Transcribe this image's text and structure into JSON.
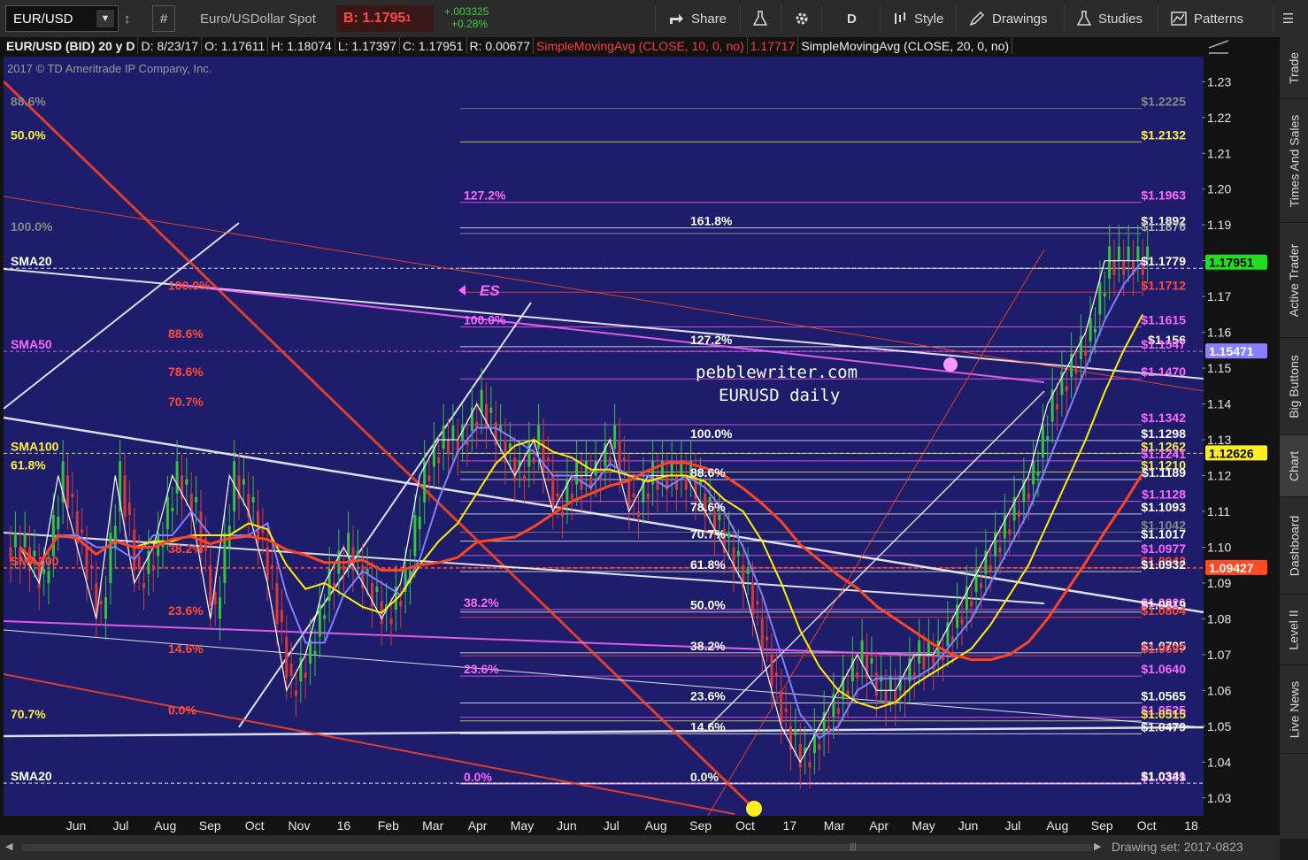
{
  "toolbar": {
    "symbol": "EUR/USD",
    "description": "Euro/USDollar Spot",
    "bid_label": "B: 1.1795",
    "bid_small": "1",
    "change_abs": "+.003325",
    "change_pct": "+0.28%",
    "share": "Share",
    "period": "D",
    "style": "Style",
    "drawings": "Drawings",
    "studies": "Studies",
    "patterns": "Patterns"
  },
  "infobar": {
    "title": "EUR/USD (BID) 20 y D",
    "date": "D: 8/23/17",
    "open": "O: 1.17611",
    "high": "H: 1.18074",
    "low": "L: 1.17397",
    "close": "C: 1.17951",
    "range": "R: 0.00677",
    "sma10_label": "SimpleMovingAvg (CLOSE, 10, 0, no)",
    "sma10_value": "1.17717",
    "sma20_label": "SimpleMovingAvg (CLOSE, 20, 0, no)"
  },
  "copyright": "2017 © TD Ameritrade IP Company, Inc.",
  "watermark": {
    "site": "pebblewriter.com",
    "subtitle": "EURUSD daily",
    "es": "ES"
  },
  "side_tabs": [
    "Trade",
    "Times And Sales",
    "Active Trader",
    "Big Buttons",
    "Chart",
    "Dashboard",
    "Level II",
    "Live News"
  ],
  "active_tab": "Chart",
  "statusbar": {
    "drawing_set": "Drawing set: 2017-0823"
  },
  "colors": {
    "background": "#1d1d6b",
    "candle_up": "#36c23a",
    "candle_down": "#d33a3a",
    "fib_red": "#ff4a3a",
    "fib_magenta": "#ff66ff",
    "fib_white": "#ffffff",
    "fib_yellow": "#ffee44",
    "sma10": "#ffffff",
    "sma20": "#7f80ff",
    "sma50": "#ffee00",
    "sma200": "#ff4422"
  },
  "chart_data": {
    "type": "line",
    "title": "",
    "ylim": [
      1.025,
      1.237
    ],
    "y_ticks": [
      1.03,
      1.04,
      1.05,
      1.06,
      1.07,
      1.08,
      1.09,
      1.1,
      1.11,
      1.12,
      1.13,
      1.14,
      1.15,
      1.16,
      1.17,
      1.18,
      1.19,
      1.2,
      1.21,
      1.22,
      1.23
    ],
    "x_months": [
      "Jun",
      "Jul",
      "Aug",
      "Sep",
      "Oct",
      "Nov",
      "16",
      "Feb",
      "Mar",
      "Apr",
      "May",
      "Jun",
      "Jul",
      "Aug",
      "Sep",
      "Oct",
      "17",
      "Mar",
      "Apr",
      "May",
      "Jun",
      "Jul",
      "Aug",
      "Sep",
      "Oct",
      "18"
    ],
    "close_series": [
      1.1,
      1.09,
      1.12,
      1.1,
      1.08,
      1.12,
      1.09,
      1.1,
      1.12,
      1.11,
      1.08,
      1.12,
      1.11,
      1.09,
      1.06,
      1.07,
      1.09,
      1.1,
      1.09,
      1.08,
      1.09,
      1.12,
      1.13,
      1.13,
      1.14,
      1.13,
      1.12,
      1.13,
      1.11,
      1.12,
      1.12,
      1.13,
      1.11,
      1.12,
      1.12,
      1.12,
      1.11,
      1.1,
      1.09,
      1.07,
      1.05,
      1.04,
      1.05,
      1.06,
      1.07,
      1.06,
      1.06,
      1.07,
      1.07,
      1.08,
      1.09,
      1.1,
      1.11,
      1.12,
      1.14,
      1.15,
      1.16,
      1.18,
      1.18,
      1.18
    ],
    "series": [
      {
        "name": "SimpleMovingAvg (CLOSE, 10, 0, no)",
        "color": "#ffffff"
      },
      {
        "name": "SimpleMovingAvg (CLOSE, 20, 0, no)",
        "color": "#7f80ff"
      },
      {
        "name": "SMA50",
        "color": "#ffee00"
      },
      {
        "name": "SMA200",
        "color": "#ff4422"
      }
    ],
    "right_axis_badges": [
      {
        "label": "1.17951",
        "value": 1.1795,
        "bg": "#22dd22",
        "fg": "#000000"
      },
      {
        "label": "1.15471",
        "value": 1.1547,
        "bg": "#8a80ff",
        "fg": "#ffffff"
      },
      {
        "label": "1.12626",
        "value": 1.1262,
        "bg": "#ffee22",
        "fg": "#000000"
      },
      {
        "label": "1.09427",
        "value": 1.0942,
        "bg": "#ff4a22",
        "fg": "#ffffff"
      }
    ],
    "price_labels": [
      {
        "text": "$1.2225",
        "value": 1.2225,
        "color": "#888888"
      },
      {
        "text": "$1.2132",
        "value": 1.2132,
        "color": "#ffee44"
      },
      {
        "text": "$1.1963",
        "value": 1.1963,
        "color": "#ff66ff"
      },
      {
        "text": "$1.1892",
        "value": 1.1892,
        "color": "#ffffff"
      },
      {
        "text": "$1.1876",
        "value": 1.1876,
        "color": "#aaaaaa"
      },
      {
        "text": "$1.1779",
        "value": 1.1779,
        "color": "#ffffff"
      },
      {
        "text": "$1.1712",
        "value": 1.1712,
        "color": "#ff4a3a"
      },
      {
        "text": "$1.1615",
        "value": 1.1615,
        "color": "#ff66ff"
      },
      {
        "text": "$1.156",
        "value": 1.156,
        "color": "#ffffff"
      },
      {
        "text": "$1.1547",
        "value": 1.1547,
        "color": "#ff66ff"
      },
      {
        "text": "$1.1470",
        "value": 1.147,
        "color": "#ff66ff"
      },
      {
        "text": "$1.1342",
        "value": 1.1342,
        "color": "#ff66ff"
      },
      {
        "text": "$1.1298",
        "value": 1.1298,
        "color": "#ffffff"
      },
      {
        "text": "$1.1262",
        "value": 1.1262,
        "color": "#ffee44"
      },
      {
        "text": "$1.1241",
        "value": 1.1241,
        "color": "#ff66ff"
      },
      {
        "text": "$1.1210",
        "value": 1.121,
        "color": "#ffee44"
      },
      {
        "text": "$1.1189",
        "value": 1.1189,
        "color": "#ffffff"
      },
      {
        "text": "$1.1128",
        "value": 1.1128,
        "color": "#ff66ff"
      },
      {
        "text": "$1.1093",
        "value": 1.1093,
        "color": "#ffffff"
      },
      {
        "text": "$1.1042",
        "value": 1.1042,
        "color": "#888888"
      },
      {
        "text": "$1.1017",
        "value": 1.1017,
        "color": "#ffffff"
      },
      {
        "text": "$1.0977",
        "value": 1.0977,
        "color": "#ff66ff"
      },
      {
        "text": "$1.0942",
        "value": 1.0942,
        "color": "#ff4a3a"
      },
      {
        "text": "$1.0932",
        "value": 1.0932,
        "color": "#ffffff"
      },
      {
        "text": "$1.0826",
        "value": 1.0826,
        "color": "#ff66ff"
      },
      {
        "text": "$1.0819",
        "value": 1.0819,
        "color": "#ffffff"
      },
      {
        "text": "$1.0804",
        "value": 1.0804,
        "color": "#ff4a3a"
      },
      {
        "text": "$1.0705",
        "value": 1.0705,
        "color": "#ffffff"
      },
      {
        "text": "$1.0697",
        "value": 1.0697,
        "color": "#ff4a3a"
      },
      {
        "text": "$1.0640",
        "value": 1.064,
        "color": "#ff66ff"
      },
      {
        "text": "$1.0565",
        "value": 1.0565,
        "color": "#ffffff"
      },
      {
        "text": "$1.0525",
        "value": 1.0525,
        "color": "#ff66ff"
      },
      {
        "text": "$1.0515",
        "value": 1.0515,
        "color": "#ffee44"
      },
      {
        "text": "$1.0479",
        "value": 1.0479,
        "color": "#ffffff"
      },
      {
        "text": "$1.0339",
        "value": 1.0339,
        "color": "#ffffff"
      },
      {
        "text": "$1.0339",
        "value": 1.0339,
        "color": "#ff66ff"
      },
      {
        "text": "$1.0341",
        "value": 1.0341,
        "color": "#ffffff"
      }
    ],
    "fib_labels": [
      {
        "text": "88.6%",
        "value": 1.2225,
        "color": "#888888"
      },
      {
        "text": "50.0%",
        "value": 1.2132,
        "color": "#ffee44"
      },
      {
        "text": "127.2%",
        "value": 1.1963,
        "color": "#ff66ff"
      },
      {
        "text": "161.8%",
        "value": 1.1892,
        "color": "#ffffff"
      },
      {
        "text": "100.0%",
        "value": 1.1876,
        "color": "#888888"
      },
      {
        "text": "100.0%",
        "value": 1.1712,
        "color": "#ff4a3a"
      },
      {
        "text": "100.0%",
        "value": 1.1615,
        "color": "#ff66ff"
      },
      {
        "text": "127.2%",
        "value": 1.156,
        "color": "#ffffff"
      },
      {
        "text": "88.6%",
        "value": 1.1577,
        "color": "#ff4a3a"
      },
      {
        "text": "78.6%",
        "value": 1.147,
        "color": "#ff4a3a"
      },
      {
        "text": "70.7%",
        "value": 1.1387,
        "color": "#ff4a3a"
      },
      {
        "text": "100.0%",
        "value": 1.1298,
        "color": "#ffffff"
      },
      {
        "text": "61.8%",
        "value": 1.121,
        "color": "#ffee44"
      },
      {
        "text": "88.6%",
        "value": 1.1189,
        "color": "#ffffff"
      },
      {
        "text": "78.6%",
        "value": 1.1093,
        "color": "#ffffff"
      },
      {
        "text": "70.7%",
        "value": 1.1017,
        "color": "#ffffff"
      },
      {
        "text": "38.2%",
        "value": 1.0977,
        "color": "#ff4a3a"
      },
      {
        "text": "61.8%",
        "value": 1.0932,
        "color": "#ffffff"
      },
      {
        "text": "38.2%",
        "value": 1.0826,
        "color": "#ff66ff"
      },
      {
        "text": "50.0%",
        "value": 1.0819,
        "color": "#ffffff"
      },
      {
        "text": "23.6%",
        "value": 1.0804,
        "color": "#ff4a3a"
      },
      {
        "text": "38.2%",
        "value": 1.0705,
        "color": "#ffffff"
      },
      {
        "text": "14.6%",
        "value": 1.0697,
        "color": "#ff4a3a"
      },
      {
        "text": "23.6%",
        "value": 1.064,
        "color": "#ff66ff"
      },
      {
        "text": "23.6%",
        "value": 1.0565,
        "color": "#ffffff"
      },
      {
        "text": "70.7%",
        "value": 1.0515,
        "color": "#ffee44"
      },
      {
        "text": "0.0%",
        "value": 1.0525,
        "color": "#ff4a3a"
      },
      {
        "text": "14.6%",
        "value": 1.0479,
        "color": "#ffffff"
      },
      {
        "text": "0.0%",
        "value": 1.0339,
        "color": "#ff66ff"
      },
      {
        "text": "0.0%",
        "value": 1.0339,
        "color": "#ffffff"
      }
    ],
    "sma_tags": [
      {
        "text": "SMA20",
        "value": 1.1779,
        "color": "#ffffff"
      },
      {
        "text": "SMA50",
        "value": 1.1547,
        "color": "#ff66ff"
      },
      {
        "text": "SMA100",
        "value": 1.1262,
        "color": "#ffee44"
      },
      {
        "text": "SMA200",
        "value": 1.0942,
        "color": "#ff4a3a"
      },
      {
        "text": "SMA20",
        "value": 1.0341,
        "color": "#ffffff"
      }
    ]
  }
}
